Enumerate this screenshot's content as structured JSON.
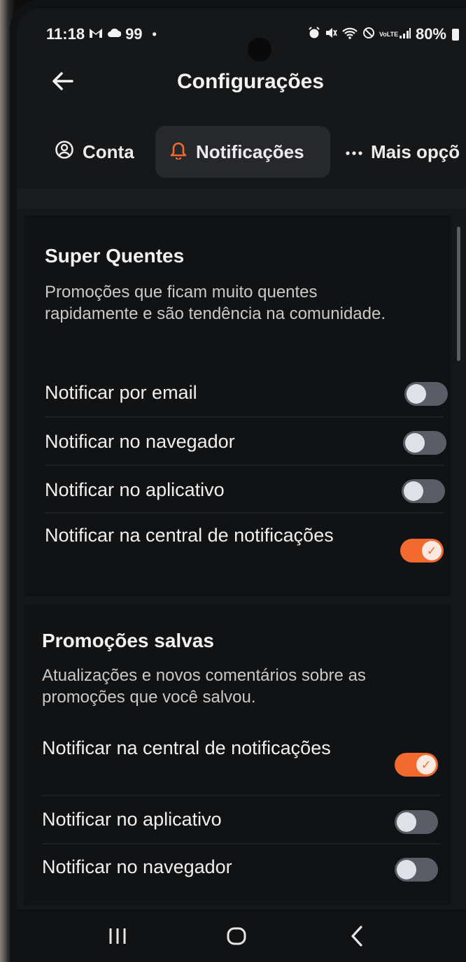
{
  "status_bar": {
    "time": "11:18",
    "left_icons": [
      "gmail-icon",
      "cloud-icon"
    ],
    "notification_count": "99",
    "dot": "•",
    "right_icons": [
      "alarm-icon",
      "mute-icon",
      "wifi-icon",
      "do-not-disturb-icon",
      "volte-icon",
      "signal-icon"
    ],
    "volte_text": "VoLTE",
    "battery": "80%"
  },
  "header": {
    "title": "Configurações",
    "back_icon": "arrow-left-icon"
  },
  "tabs": [
    {
      "label": "Conta",
      "icon": "account-circle-icon",
      "selected": false
    },
    {
      "label": "Notificações",
      "icon": "bell-icon",
      "selected": true
    },
    {
      "label": "Mais opçõ",
      "icon": "more-dots-icon",
      "selected": false
    }
  ],
  "sections": [
    {
      "title": "Super Quentes",
      "description": "Promoções que ficam muito quentes rapidamente e são tendência na comunidade.",
      "settings": [
        {
          "label": "Notificar por email",
          "enabled": false
        },
        {
          "label": "Notificar no navegador",
          "enabled": false
        },
        {
          "label": "Notificar no aplicativo",
          "enabled": false
        },
        {
          "label": "Notificar na central de notificações",
          "enabled": true
        }
      ]
    },
    {
      "title": "Promoções salvas",
      "description": "Atualizações e novos comentários sobre as promoções que você salvou.",
      "settings": [
        {
          "label": "Notificar na central de notificações",
          "enabled": true
        },
        {
          "label": "Notificar no aplicativo",
          "enabled": false
        },
        {
          "label": "Notificar no navegador",
          "enabled": false
        }
      ]
    }
  ],
  "nav_bar": {
    "buttons": [
      "recent-apps-icon",
      "home-icon",
      "back-icon"
    ]
  },
  "colors": {
    "accent": "#f26a2e",
    "background": "#161719",
    "card": "#111214",
    "toggle_off": "#5a5d66"
  }
}
